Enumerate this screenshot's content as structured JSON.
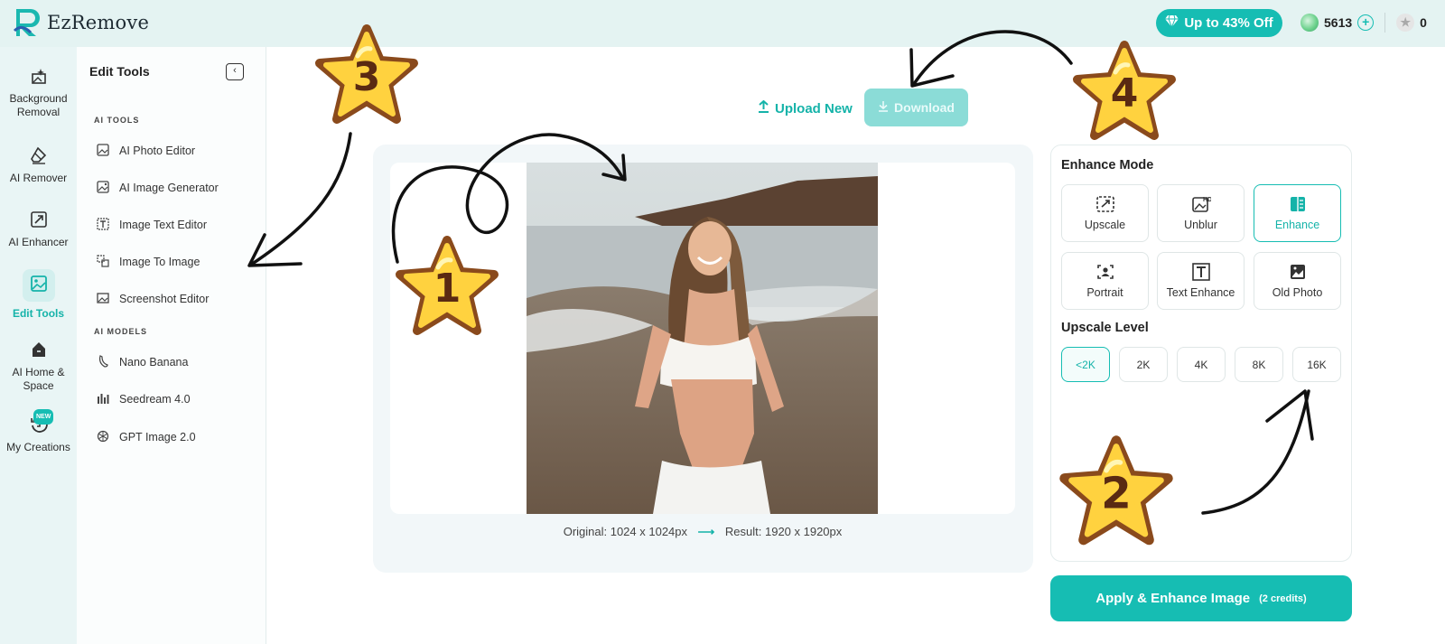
{
  "app": {
    "name": "EzRemove"
  },
  "topbar": {
    "promo_label": "Up to 43% Off",
    "credit_balance": "5613",
    "star_balance": "0"
  },
  "leftnav": {
    "items": [
      {
        "label": "Background Removal"
      },
      {
        "label": "AI Remover"
      },
      {
        "label": "AI Enhancer"
      },
      {
        "label": "Edit Tools"
      },
      {
        "label": "AI Home & Space"
      },
      {
        "label": "My Creations",
        "badge": "NEW"
      }
    ]
  },
  "tools_panel": {
    "title": "Edit Tools",
    "sections": [
      {
        "label": "AI TOOLS",
        "items": [
          "AI Photo Editor",
          "AI Image Generator",
          "Image Text Editor",
          "Image To Image",
          "Screenshot Editor"
        ]
      },
      {
        "label": "AI MODELS",
        "items": [
          "Nano Banana",
          "Seedream 4.0",
          "GPT Image 2.0"
        ]
      }
    ]
  },
  "toolbar": {
    "upload_label": "Upload New",
    "download_label": "Download"
  },
  "canvas": {
    "original_label": "Original: 1024 x 1024px",
    "result_label": "Result: 1920 x 1920px",
    "arrow": "⟶"
  },
  "enhance_panel": {
    "mode_title": "Enhance Mode",
    "modes": [
      "Upscale",
      "Unblur",
      "Enhance",
      "Portrait",
      "Text Enhance",
      "Old Photo"
    ],
    "selected_mode": "Enhance",
    "level_title": "Upscale Level",
    "levels": [
      "<2K",
      "2K",
      "4K",
      "8K",
      "16K"
    ],
    "selected_level": "<2K"
  },
  "apply": {
    "label": "Apply & Enhance Image",
    "credits": "(2 credits)"
  },
  "annotations": {
    "stars": [
      "1",
      "2",
      "3",
      "4"
    ]
  },
  "colors": {
    "accent": "#16bdb3",
    "star_fill": "#ffd23f",
    "star_border": "#8a4a1c"
  }
}
